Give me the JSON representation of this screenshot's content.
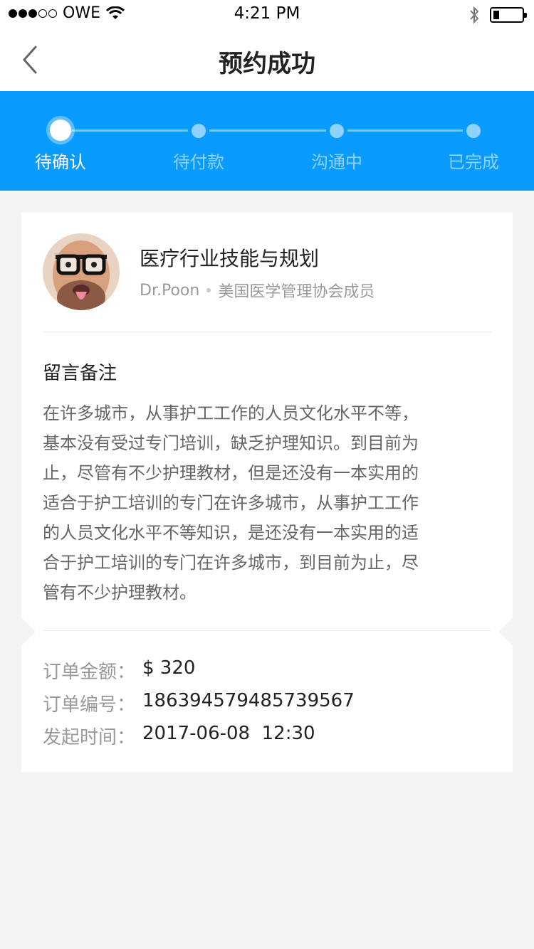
{
  "status_bar": {
    "carrier": "OWE",
    "time": "4:21 PM"
  },
  "nav": {
    "title": "预约成功"
  },
  "steps": [
    {
      "label": "待确认",
      "active": true
    },
    {
      "label": "待付款",
      "active": false
    },
    {
      "label": "沟通中",
      "active": false
    },
    {
      "label": "已完成",
      "active": false
    }
  ],
  "course": {
    "title": "医疗行业技能与规划",
    "doctor": "Dr.Poon",
    "affiliation": "美国医学管理协会成员"
  },
  "note": {
    "heading": "留言备注",
    "lines": [
      "在许多城市，从事护工工作的人员文化水平不等，",
      "基本没有受过专门培训，缺乏护理知识。到目前为",
      "止，尽管有不少护理教材，但是还没有一本实用的",
      "适合于护工培训的专门在许多城市，从事护工工作",
      "的人员文化水平不等知识，是还没有一本实用的适",
      "合于护工培训的专门在许多城市，到目前为止，尽",
      "管有不少护理教材。"
    ]
  },
  "order": {
    "amount_label": "订单金额：",
    "amount_value": "$ 320",
    "number_label": "订单编号：",
    "number_value": "186394579485739567",
    "time_label": "发起时间：",
    "time_value": "2017-06-08  12:30"
  },
  "colors": {
    "accent": "#0a9bff",
    "background": "#f3f4f6"
  }
}
